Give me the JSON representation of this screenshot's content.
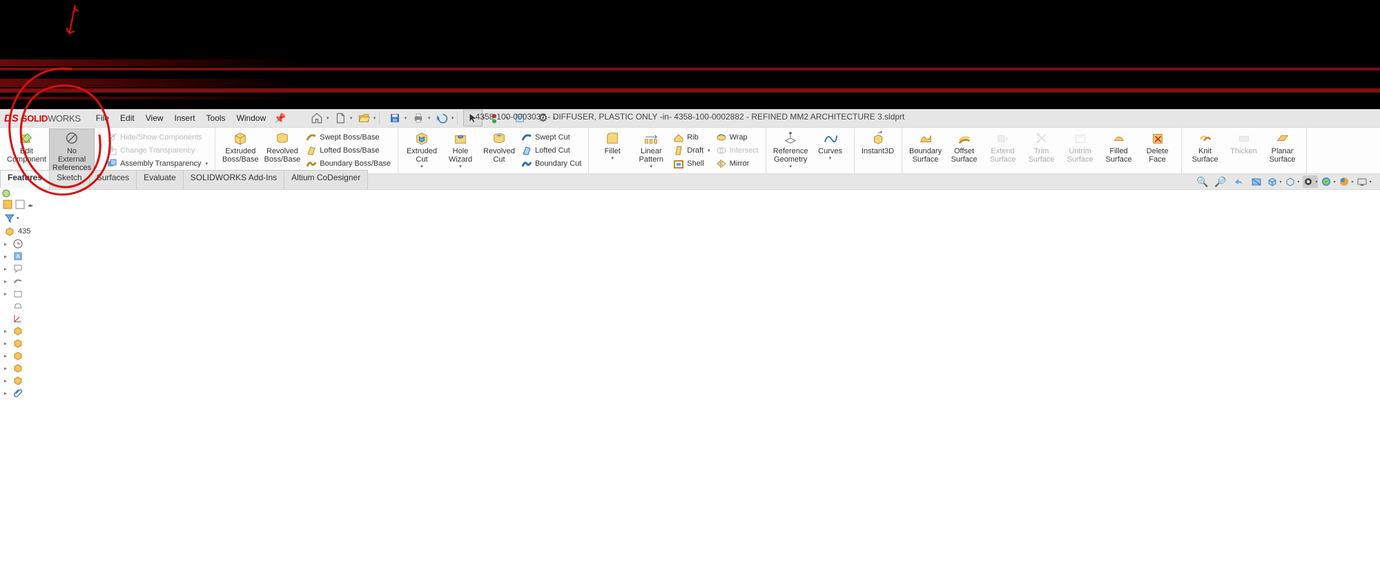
{
  "app": {
    "brand_prefix": "DS",
    "brand_bold": "SOLID",
    "brand_light": "WORKS",
    "title": "4358-100-0003037 - DIFFUSER, PLASTIC ONLY -in- 4358-100-0002882 - REFINED MM2 ARCHITECTURE 3.sldprt"
  },
  "menu": [
    "File",
    "Edit",
    "View",
    "Insert",
    "Tools",
    "Window"
  ],
  "ribbon": {
    "edit_component": "Edit\nComponent",
    "no_external": "No\nExternal\nReferences",
    "hide_show": "Hide/Show Components",
    "change_transparency": "Change Transparency",
    "assembly_transparency": "Assembly Transparency",
    "extruded_boss": "Extruded\nBoss/Base",
    "revolved_boss": "Revolved\nBoss/Base",
    "swept_boss": "Swept Boss/Base",
    "lofted_boss": "Lofted Boss/Base",
    "boundary_boss": "Boundary Boss/Base",
    "extruded_cut": "Extruded\nCut",
    "hole_wizard": "Hole\nWizard",
    "revolved_cut": "Revolved\nCut",
    "swept_cut": "Swept Cut",
    "lofted_cut": "Lofted Cut",
    "boundary_cut": "Boundary Cut",
    "fillet": "Fillet",
    "linear_pattern": "Linear\nPattern",
    "rib": "Rib",
    "draft": "Draft",
    "shell": "Shell",
    "wrap": "Wrap",
    "intersect": "Intersect",
    "mirror": "Mirror",
    "ref_geometry": "Reference\nGeometry",
    "curves": "Curves",
    "instant3d": "Instant3D",
    "boundary_surf": "Boundary\nSurface",
    "offset_surf": "Offset\nSurface",
    "extend_surf": "Extend\nSurface",
    "trim_surf": "Trim\nSurface",
    "untrim_surf": "Untrim\nSurface",
    "filled_surf": "Filled\nSurface",
    "delete_face": "Delete\nFace",
    "knit_surf": "Knit\nSurface",
    "thicken": "Thicken",
    "planar_surf": "Planar\nSurface"
  },
  "tabs": [
    "Features",
    "Sketch",
    "Surfaces",
    "Evaluate",
    "SOLIDWORKS Add-Ins",
    "Altium CoDesigner"
  ],
  "tree_root": "435"
}
